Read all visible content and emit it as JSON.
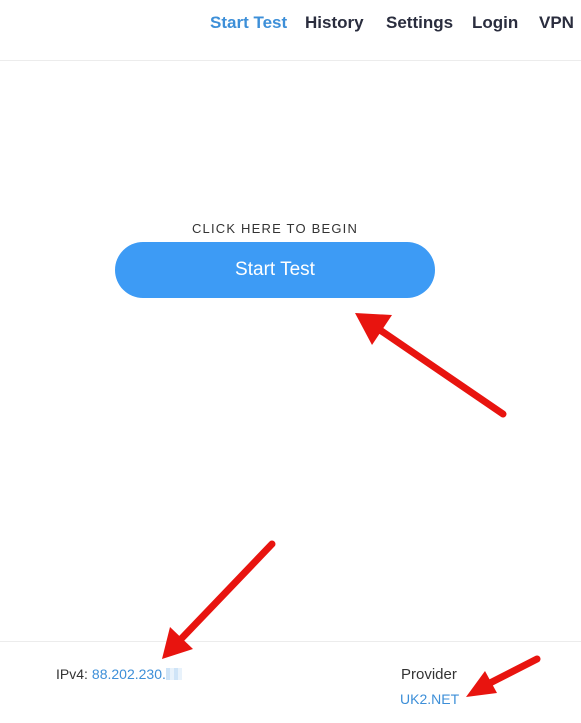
{
  "nav": {
    "items": [
      {
        "label": "Start Test",
        "active": true
      },
      {
        "label": "History",
        "active": false
      },
      {
        "label": "Settings",
        "active": false
      },
      {
        "label": "Login",
        "active": false
      },
      {
        "label": "VPN",
        "active": false
      }
    ]
  },
  "main": {
    "caption": "CLICK HERE TO BEGIN",
    "button_label": "Start Test"
  },
  "footer": {
    "ip_label": "IPv4:",
    "ip_value": "88.202.230.",
    "provider_label": "Provider",
    "provider_value": "UK2.NET"
  },
  "colors": {
    "accent": "#3d8fd8",
    "button": "#3d9bf5",
    "nav_text": "#2a2d3e",
    "annotation_arrow": "#e8140f"
  },
  "annotations": {
    "arrow_count": 3,
    "icon": "red-arrow-icon"
  }
}
